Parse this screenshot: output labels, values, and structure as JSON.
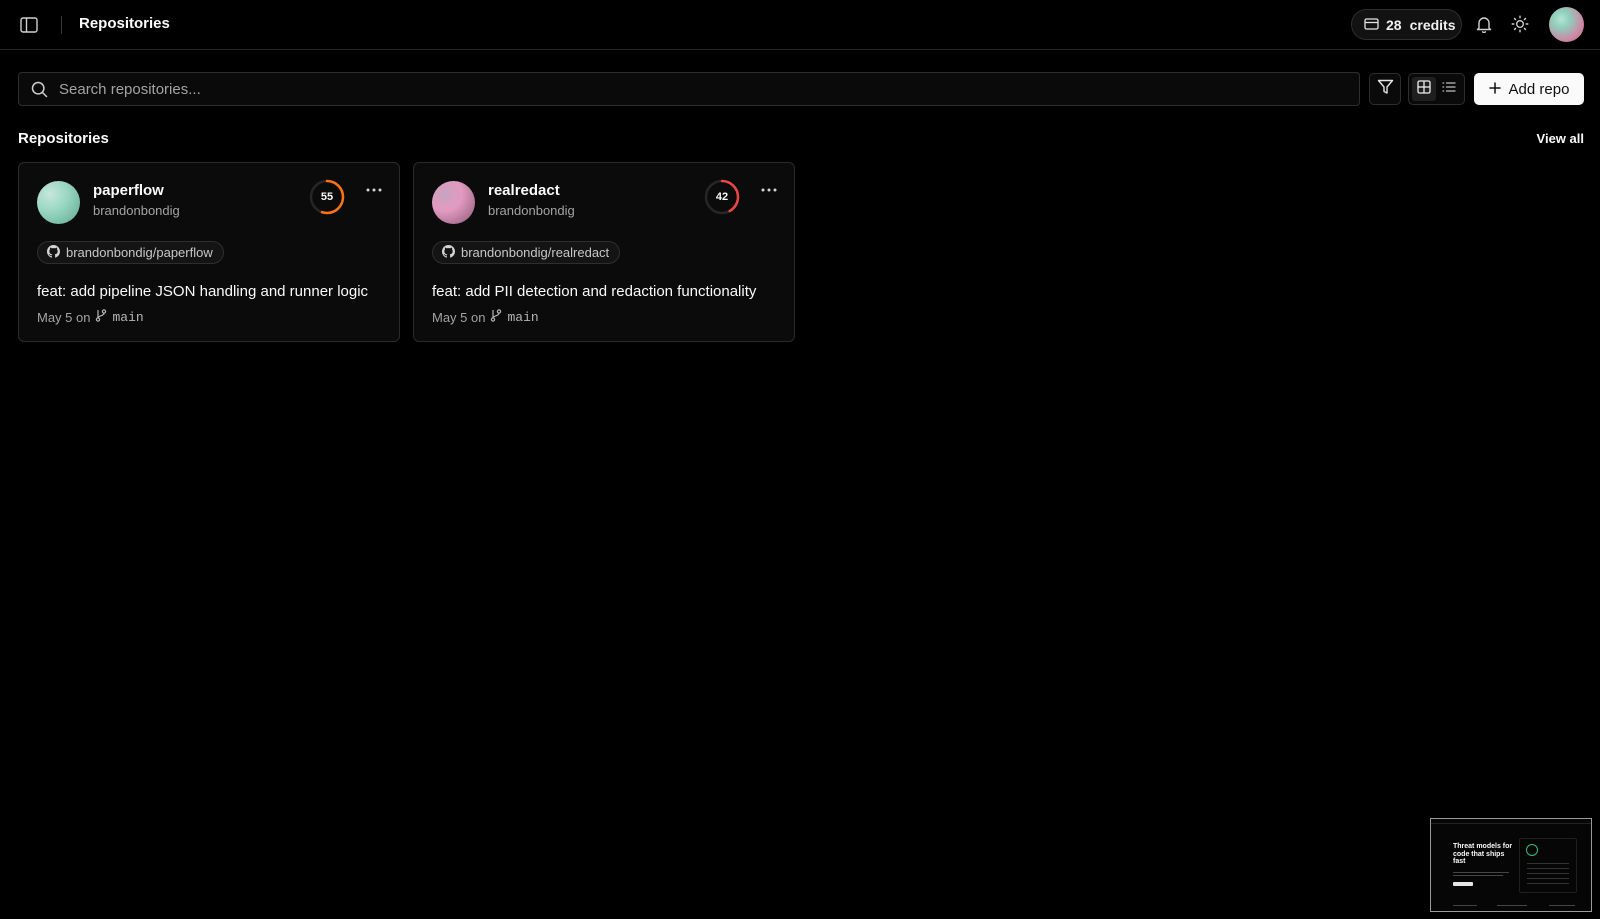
{
  "header": {
    "title": "Repositories",
    "credits_count": "28",
    "credits_label": "credits"
  },
  "toolbar": {
    "search_placeholder": "Search repositories...",
    "add_repo_label": "Add repo"
  },
  "section": {
    "title": "Repositories",
    "view_all_label": "View all"
  },
  "repos": [
    {
      "name": "paperflow",
      "owner": "brandonbondig",
      "score": 55,
      "score_color": "#f97316",
      "github_path": "brandonbondig/paperflow",
      "last_commit": "feat: add pipeline JSON handling and runner logic",
      "date_text": "May 5 on",
      "branch": "main",
      "avatar_gradient": [
        "#9ad8c4",
        "#5fa88f",
        "#c6e7d9"
      ]
    },
    {
      "name": "realredact",
      "owner": "brandonbondig",
      "score": 42,
      "score_color": "#ef4444",
      "github_path": "brandonbondig/realredact",
      "last_commit": "feat: add PII detection and redaction functionality",
      "date_text": "May 5 on",
      "branch": "main",
      "avatar_gradient": [
        "#e39ac0",
        "#8a5a7a",
        "#c9a3c0"
      ]
    }
  ],
  "preview": {
    "headline": "Threat models for code that ships fast"
  }
}
